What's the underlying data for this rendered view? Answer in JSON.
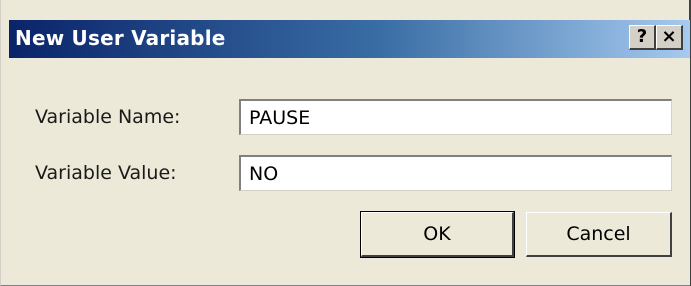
{
  "window": {
    "title": "New User Variable",
    "help_glyph": "?",
    "close_glyph": "×"
  },
  "form": {
    "name_label": "Variable Name:",
    "name_value": "PAUSE",
    "value_label": "Variable Value:",
    "value_value": "NO"
  },
  "buttons": {
    "ok_label": "OK",
    "cancel_label": "Cancel"
  },
  "colors": {
    "title_gradient_start": "#0a246a",
    "title_gradient_end": "#a6caf0",
    "dialog_face": "#ece9d8"
  },
  "icons": [
    "help-icon",
    "close-icon"
  ]
}
